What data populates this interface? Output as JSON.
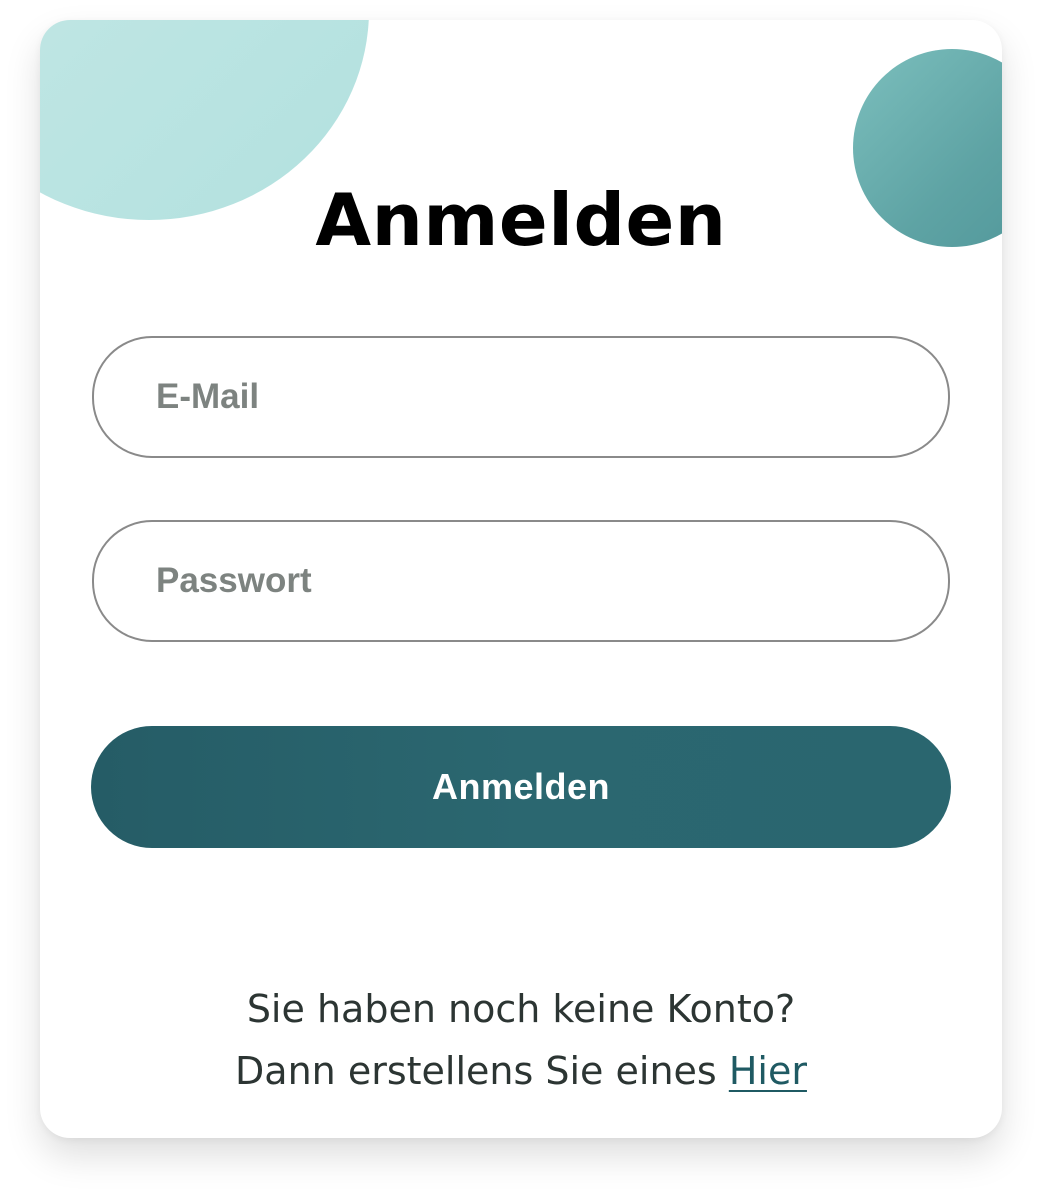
{
  "login": {
    "title": "Anmelden",
    "email_placeholder": "E-Mail",
    "password_placeholder": "Passwort",
    "submit_label": "Anmelden",
    "footer_line1": "Sie haben noch keine Konto?",
    "footer_line2": "Dann erstellens Sie eines",
    "register_link": "Hier"
  },
  "colors": {
    "accent": "#2a666f",
    "blob_light": "#b7e3e1",
    "blob_dark": "#5ea3a4"
  }
}
